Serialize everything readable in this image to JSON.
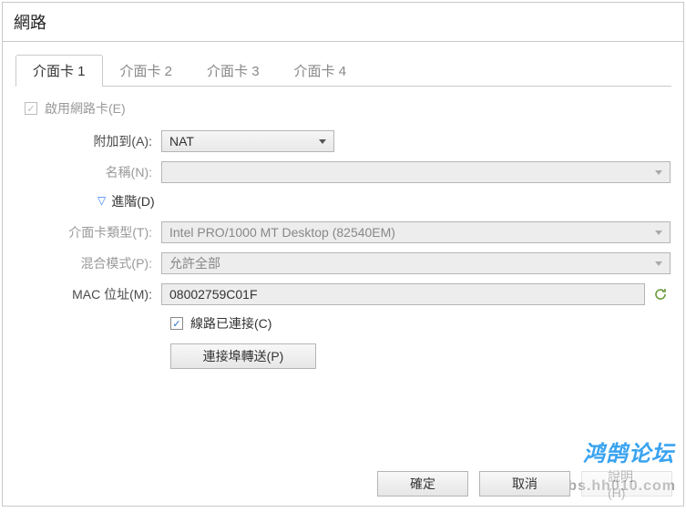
{
  "window": {
    "title": "網路"
  },
  "tabs": [
    {
      "label": "介面卡 1",
      "active": true
    },
    {
      "label": "介面卡 2",
      "active": false
    },
    {
      "label": "介面卡 3",
      "active": false
    },
    {
      "label": "介面卡 4",
      "active": false
    }
  ],
  "form": {
    "enable_nic_label": "啟用網路卡(E)",
    "enable_nic_checked": true,
    "attached_to_label": "附加到(A):",
    "attached_to_value": "NAT",
    "name_label": "名稱(N):",
    "name_value": "",
    "advanced_label": "進階(D)",
    "adapter_type_label": "介面卡類型(T):",
    "adapter_type_value": "Intel PRO/1000 MT Desktop (82540EM)",
    "promiscuous_label": "混合模式(P):",
    "promiscuous_value": "允許全部",
    "mac_label": "MAC 位址(M):",
    "mac_value": "08002759C01F",
    "cable_connected_label": "線路已連接(C)",
    "cable_connected_checked": true,
    "port_forwarding_label": "連接埠轉送(P)"
  },
  "buttons": {
    "ok": "確定",
    "cancel": "取消",
    "help": "說明(H)"
  },
  "watermark": {
    "cn": "鸿鹄论坛",
    "url": "bbs.hh010.com"
  }
}
